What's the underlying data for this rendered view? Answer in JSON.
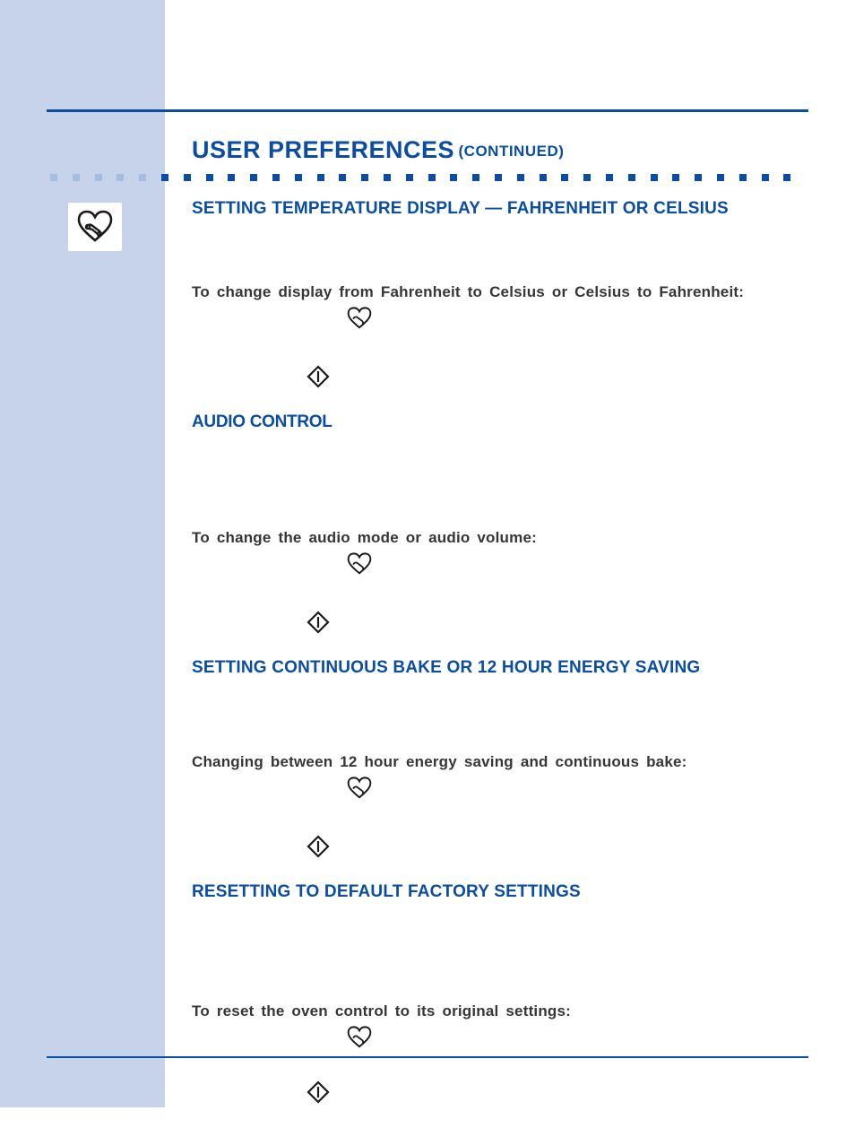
{
  "heading": {
    "main": "USER PREFERENCES",
    "continued": "(CONTINUED)"
  },
  "sections": [
    {
      "title": "SETTING TEMPERATURE DISPLAY — FAHRENHEIT OR CELSIUS",
      "body": "To change display from Fahrenheit to Celsius or Celsius to Fahrenheit:"
    },
    {
      "title": "AUDIO CONTROL",
      "body": "To change the audio mode or audio volume:"
    },
    {
      "title": "SETTING CONTINUOUS BAKE OR 12 HOUR ENERGY SAVING",
      "body": "Changing between 12 hour energy saving and continuous bake:"
    },
    {
      "title": "RESETTING TO DEFAULT FACTORY SETTINGS",
      "body": "To reset the oven control to its original settings:"
    }
  ]
}
